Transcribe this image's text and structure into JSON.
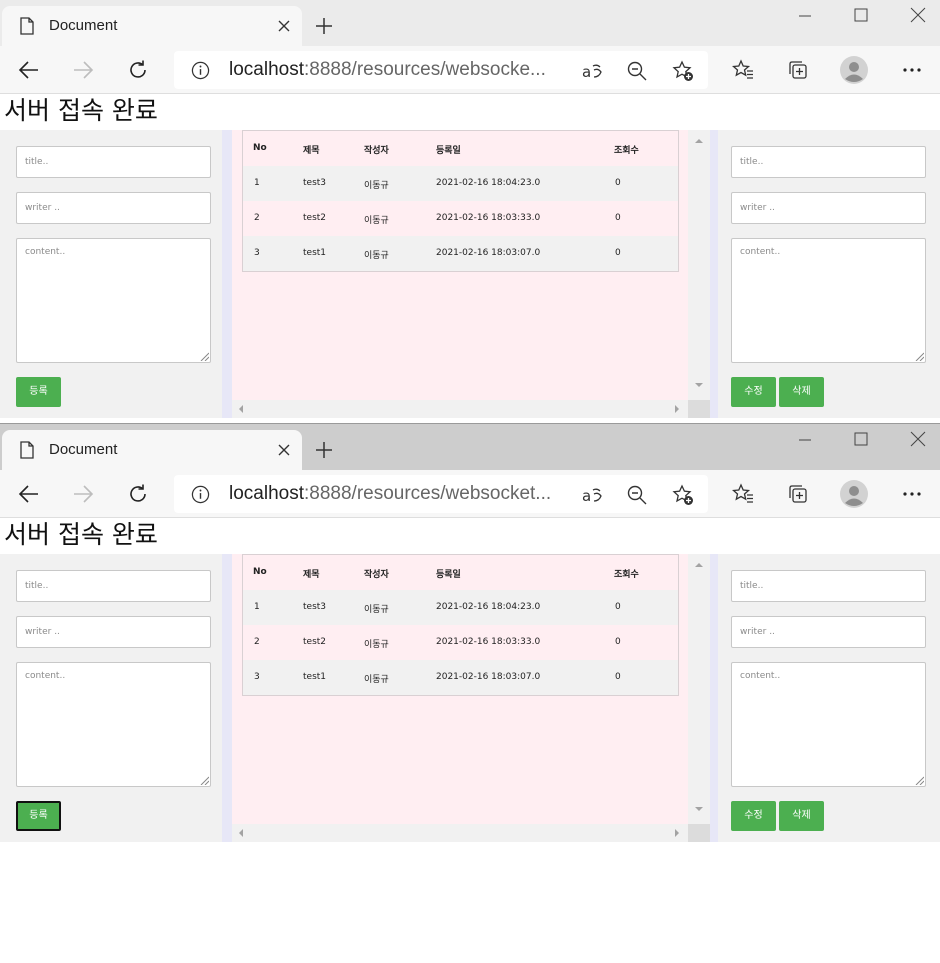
{
  "windows": [
    {
      "tab": {
        "title": "Document"
      },
      "address": {
        "host": "localhost",
        "rest": ":8888/resources/websocke..."
      },
      "heading": "서버 접속 완료",
      "left_form": {
        "title_placeholder": "title..",
        "writer_placeholder": "writer ..",
        "content_placeholder": "content..",
        "submit_label": "등록",
        "submit_focused": false
      },
      "table": {
        "columns": [
          "No",
          "제목",
          "작성자",
          "등록일",
          "조회수"
        ],
        "rows": [
          [
            "1",
            "test3",
            "이동규",
            "2021-02-16 18:04:23.0",
            "0"
          ],
          [
            "2",
            "test2",
            "이동규",
            "2021-02-16 18:03:33.0",
            "0"
          ],
          [
            "3",
            "test1",
            "이동규",
            "2021-02-16 18:03:07.0",
            "0"
          ]
        ]
      },
      "right_form": {
        "title_placeholder": "title..",
        "writer_placeholder": "writer ..",
        "content_placeholder": "content..",
        "edit_label": "수정",
        "delete_label": "삭제"
      }
    },
    {
      "tab": {
        "title": "Document"
      },
      "address": {
        "host": "localhost",
        "rest": ":8888/resources/websocket..."
      },
      "heading": "서버 접속 완료",
      "left_form": {
        "title_placeholder": "title..",
        "writer_placeholder": "writer ..",
        "content_placeholder": "content..",
        "submit_label": "등록",
        "submit_focused": true
      },
      "table": {
        "columns": [
          "No",
          "제목",
          "작성자",
          "등록일",
          "조회수"
        ],
        "rows": [
          [
            "1",
            "test3",
            "이동규",
            "2021-02-16 18:04:23.0",
            "0"
          ],
          [
            "2",
            "test2",
            "이동규",
            "2021-02-16 18:03:33.0",
            "0"
          ],
          [
            "3",
            "test1",
            "이동규",
            "2021-02-16 18:03:07.0",
            "0"
          ]
        ]
      },
      "right_form": {
        "title_placeholder": "title..",
        "writer_placeholder": "writer ..",
        "content_placeholder": "content..",
        "edit_label": "수정",
        "delete_label": "삭제"
      }
    }
  ],
  "colors": {
    "button_green": "#4caf50",
    "board_pink": "#ffeef2",
    "panel_gray": "#f1f1f1"
  },
  "icons": [
    "document-icon",
    "close-icon",
    "new-tab-icon",
    "minimize-icon",
    "maximize-icon",
    "window-close-icon",
    "back-icon",
    "forward-icon",
    "refresh-icon",
    "info-icon",
    "read-aloud-icon",
    "zoom-out-icon",
    "add-favorite-icon",
    "favorites-icon",
    "collections-icon",
    "profile-icon",
    "more-icon"
  ]
}
